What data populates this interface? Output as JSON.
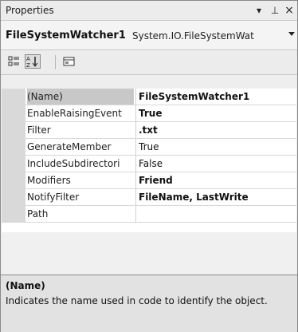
{
  "window": {
    "title": "Properties"
  },
  "title_buttons": {
    "dropdown": "▾",
    "pin": "⊥",
    "close": "×"
  },
  "object_bar": {
    "name": "FileSystemWatcher1",
    "type": "System.IO.FileSystemWat"
  },
  "toolbar": {
    "categorized_icon": "categorized-icon",
    "alphabetical_icon": "alphabetical-icon",
    "property_pages_icon": "property-pages-icon"
  },
  "properties": [
    {
      "name": "(Name)",
      "value": "FileSystemWatcher1",
      "bold": true
    },
    {
      "name": "EnableRaisingEvent",
      "value": "True",
      "bold": true
    },
    {
      "name": "Filter",
      "value": ".txt",
      "bold": true
    },
    {
      "name": "GenerateMember",
      "value": "True",
      "bold": false
    },
    {
      "name": "IncludeSubdirectori",
      "value": "False",
      "bold": false
    },
    {
      "name": "Modifiers",
      "value": "Friend",
      "bold": true
    },
    {
      "name": "NotifyFilter",
      "value": "FileName, LastWrite",
      "bold": true
    },
    {
      "name": "Path",
      "value": "",
      "bold": false
    }
  ],
  "description": {
    "title": "(Name)",
    "text": "Indicates the name used in code to identify the object."
  },
  "colors": {
    "panel": "#eeeeee",
    "gutter": "#d9d9d9",
    "description_bg": "#e2e2e2"
  }
}
